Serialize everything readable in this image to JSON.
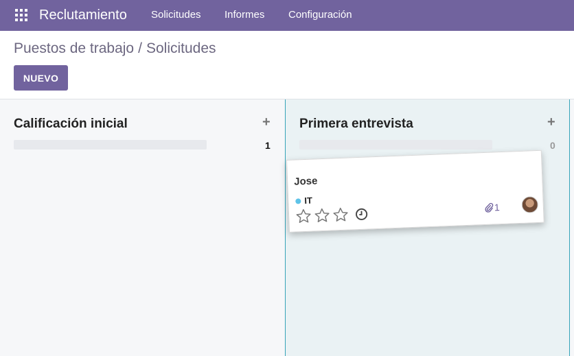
{
  "navbar": {
    "app_title": "Reclutamiento",
    "menu": [
      "Solicitudes",
      "Informes",
      "Configuración"
    ]
  },
  "breadcrumb": {
    "parent": "Puestos de trabajo",
    "separator": "/",
    "current": "Solicitudes"
  },
  "toolbar": {
    "new_label": "NUEVO"
  },
  "columns": [
    {
      "title": "Calificación inicial",
      "count": "1",
      "add_label": "+"
    },
    {
      "title": "Primera entrevista",
      "count": "0",
      "add_label": "+"
    }
  ],
  "card": {
    "name": "Jose",
    "tag": "IT",
    "tag_color": "#5ec3e8",
    "rating": 0,
    "rating_max": 3,
    "attachments": "1"
  },
  "colors": {
    "brand": "#71639e",
    "column_highlight": "#34a3b8"
  }
}
